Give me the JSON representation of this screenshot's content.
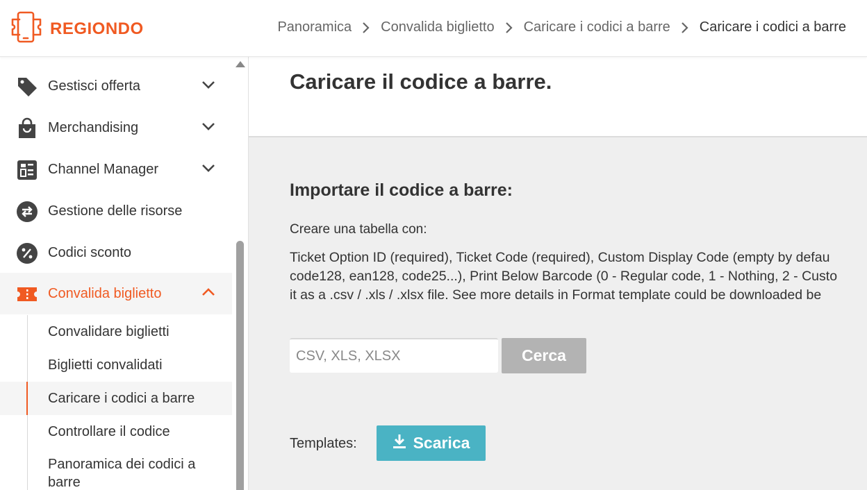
{
  "brand": {
    "name": "REGIONDO",
    "color": "#f05a22"
  },
  "breadcrumb": [
    {
      "label": "Panoramica"
    },
    {
      "label": "Convalida biglietto"
    },
    {
      "label": "Caricare i codici a barre"
    },
    {
      "label": "Caricare i codici a barre"
    }
  ],
  "sidebar": {
    "items": [
      {
        "label": "Gestisci offerta",
        "icon": "tag-icon",
        "expandable": true
      },
      {
        "label": "Merchandising",
        "icon": "shopping-bag-icon",
        "expandable": true
      },
      {
        "label": "Channel Manager",
        "icon": "dashboard-icon",
        "expandable": true
      },
      {
        "label": "Gestione delle risorse",
        "icon": "swap-arrows-icon",
        "expandable": false
      },
      {
        "label": "Codici sconto",
        "icon": "percent-icon",
        "expandable": false
      },
      {
        "label": "Convalida biglietto",
        "icon": "ticket-icon",
        "expandable": true,
        "expanded": true,
        "active": true
      }
    ],
    "subitems": [
      {
        "label": "Convalidare biglietti"
      },
      {
        "label": "Biglietti convalidati"
      },
      {
        "label": "Caricare i codici a barre",
        "selected": true
      },
      {
        "label": "Controllare il codice"
      },
      {
        "label": "Panoramica dei codici a barre"
      }
    ]
  },
  "main": {
    "title": "Caricare il codice a barre.",
    "section_title": "Importare il codice a barre:",
    "create_text": "Creare una tabella con:",
    "description_lines": [
      "Ticket Option ID (required), Ticket Code (required), Custom Display Code (empty by defau",
      "code128, ean128, code25...), Print Below Barcode (0 - Regular code, 1 - Nothing, 2 - Custo",
      "it as a .csv / .xls / .xlsx file. See more details in Format template could be downloaded be"
    ],
    "file_input_placeholder": "CSV, XLS, XLSX",
    "search_button": "Cerca",
    "templates_label": "Templates:",
    "download_button": "Scarica"
  },
  "colors": {
    "accent": "#f05a22",
    "download_button": "#4ab3c4",
    "disabled_button": "#b3b3b3"
  }
}
